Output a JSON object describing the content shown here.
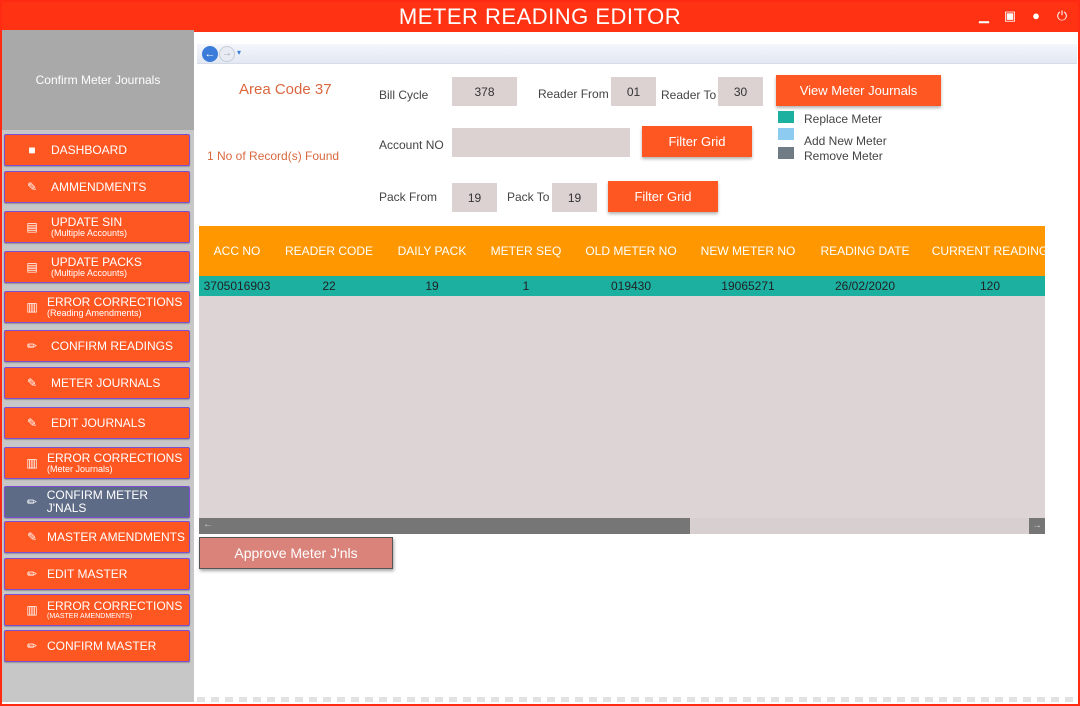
{
  "window": {
    "title": "METER READING EDITOR",
    "controls": [
      "minimize-icon",
      "maximize-icon",
      "user-icon",
      "power-icon"
    ]
  },
  "sidebar": {
    "header": "Confirm Meter Journals",
    "items": [
      {
        "label": "DASHBOARD",
        "sub": "",
        "icon": "book-icon"
      },
      {
        "label": "AMMENDMENTS",
        "sub": "",
        "icon": "user-edit-icon"
      },
      {
        "label": "UPDATE SIN",
        "sub": "(Multiple Accounts)",
        "icon": "document-icon"
      },
      {
        "label": "UPDATE PACKS",
        "sub": "(Multiple Accounts)",
        "icon": "document-icon"
      },
      {
        "label": "ERROR CORRECTIONS",
        "sub": "(Reading Amendments)",
        "icon": "stack-icon"
      },
      {
        "label": "CONFIRM READINGS",
        "sub": "",
        "icon": "pencil-icon"
      },
      {
        "label": "METER JOURNALS",
        "sub": "",
        "icon": "user-edit-icon"
      },
      {
        "label": "EDIT JOURNALS",
        "sub": "",
        "icon": "user-edit-icon"
      },
      {
        "label": "ERROR CORRECTIONS",
        "sub": "(Meter Journals)",
        "icon": "stack-icon"
      },
      {
        "label": "CONFIRM METER J'NALS",
        "sub": "",
        "icon": "pencil-icon",
        "active": true
      },
      {
        "label": "MASTER AMENDMENTS",
        "sub": "",
        "icon": "user-edit-icon"
      },
      {
        "label": "EDIT MASTER",
        "sub": "",
        "icon": "pencil-icon"
      },
      {
        "label": "ERROR CORRECTIONS",
        "sub": "(MASTER AMENDMENTS)",
        "icon": "stack-icon"
      },
      {
        "label": "CONFIRM MASTER",
        "sub": "",
        "icon": "pencil-icon"
      }
    ]
  },
  "filters": {
    "area_code": "Area Code 37",
    "records_found": "1 No of Record(s) Found",
    "bill_cycle_label": "Bill Cycle",
    "bill_cycle_value": "378",
    "reader_from_label": "Reader From",
    "reader_from_value": "01",
    "reader_to_label": "Reader To",
    "reader_to_value": "30",
    "view_journals_button": "View Meter Journals",
    "account_no_label": "Account NO",
    "account_no_value": "",
    "filter_grid_button_1": "Filter Grid",
    "pack_from_label": "Pack From",
    "pack_from_value": "19",
    "pack_to_label": "Pack To",
    "pack_to_value": "19",
    "filter_grid_button_2": "Filter Grid"
  },
  "legend": [
    {
      "label": "Replace Meter",
      "color": "#1bb0a0"
    },
    {
      "label": "Add New Meter",
      "color": "#8ecbf1"
    },
    {
      "label": "Remove Meter",
      "color": "#6f7c86"
    }
  ],
  "grid": {
    "columns": [
      "ACC NO",
      "READER CODE",
      "DAILY PACK",
      "METER SEQ",
      "OLD METER NO",
      "NEW METER NO",
      "READING DATE",
      "CURRENT READING"
    ],
    "rows": [
      [
        "3705016903",
        "22",
        "19",
        "1",
        "019430",
        "19065271",
        "26/02/2020",
        "120"
      ]
    ]
  },
  "actions": {
    "approve_button": "Approve Meter J'nls"
  },
  "colors": {
    "title_bar": "#ff3314",
    "button": "#ff5722",
    "header": "#ff9800",
    "row_highlight": "#1bb0a0",
    "active_nav": "#5e6b86"
  }
}
